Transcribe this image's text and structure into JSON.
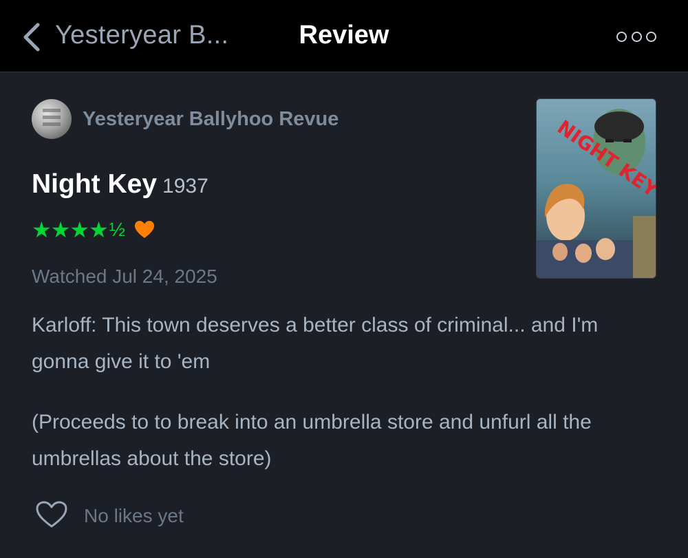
{
  "nav": {
    "back_label": "Yesteryear B...",
    "title": "Review",
    "back_icon": "chevron-left-icon",
    "more_icon": "more-options-icon"
  },
  "author": {
    "name": "Yesteryear Ballyhoo Revue"
  },
  "film": {
    "title": "Night Key",
    "year": "1937",
    "poster_text": "NIGHT KEY"
  },
  "rating": {
    "stars": "★★★★",
    "half": "½",
    "star_color": "#00d735",
    "liked": true,
    "heart_color": "#ff8000"
  },
  "watched_label": "Watched Jul 24, 2025",
  "review": {
    "paragraphs": [
      "Karloff: This town deserves a better class of criminal... and I'm gonna give it to 'em",
      "(Proceeds to to break into an umbrella store and unfurl all the umbrellas about the store)"
    ]
  },
  "likes": {
    "text": "No likes yet"
  }
}
